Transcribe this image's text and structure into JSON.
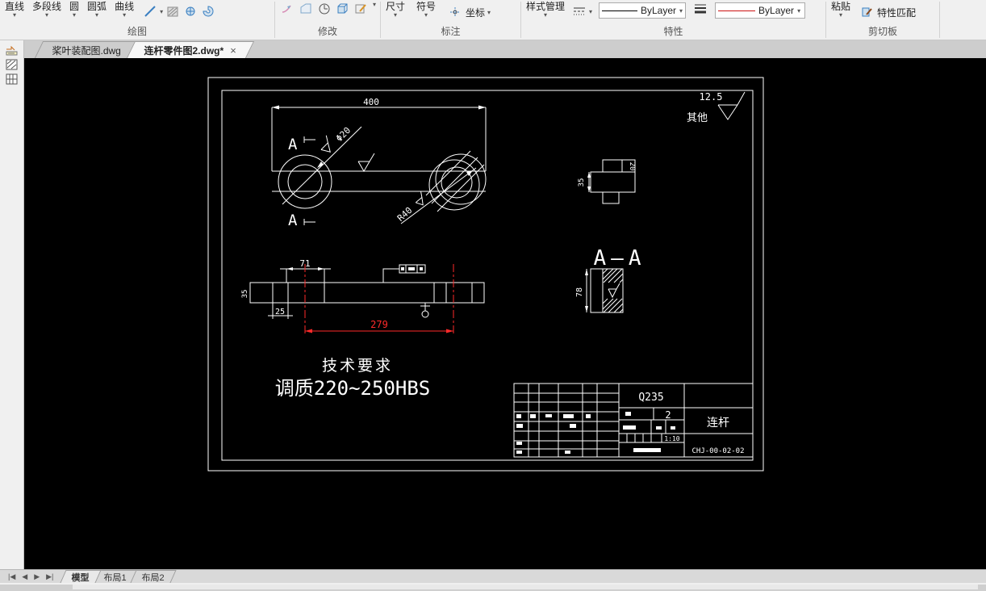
{
  "ribbon": {
    "draw": {
      "label": "绘图",
      "line": "直线",
      "polyline": "多段线",
      "circle": "圆",
      "arc": "圆弧",
      "curve": "曲线"
    },
    "modify": {
      "label": "修改"
    },
    "annotate": {
      "label": "标注",
      "dimension": "尺寸",
      "symbol": "符号",
      "coordinate": "坐标"
    },
    "properties": {
      "label": "特性",
      "style_manager": "样式管理",
      "linetype_value": "ByLayer",
      "color_value": "ByLayer"
    },
    "clipboard": {
      "label": "剪切板",
      "paste": "粘贴",
      "match_properties": "特性匹配"
    }
  },
  "file_tabs": [
    {
      "label": "桨叶装配图.dwg"
    },
    {
      "label": "连杆零件图2.dwg*"
    }
  ],
  "drawing": {
    "surface_note": {
      "value": "12.5",
      "other_text": "其他"
    },
    "top_view": {
      "length_dim": "400",
      "section_letter": "A",
      "hole_dim": "Φ20",
      "radius_dim": "R40"
    },
    "side_view": {
      "width_dim": "35",
      "depth_dim": "20"
    },
    "section_view": {
      "title": "A—A",
      "height_dim": "78"
    },
    "front_view": {
      "dim_71": "71",
      "dim_35": "35",
      "dim_25": "25",
      "dim_279": "279"
    },
    "tech_requirements": {
      "title": "技术要求",
      "line1": "调质220~250HBS"
    },
    "title_block": {
      "material": "Q235",
      "quantity": "2",
      "part_name": "连杆",
      "scale": "1:10",
      "drawing_no": "CHJ-00-02-02"
    }
  },
  "layout_tabs": {
    "model": "模型",
    "layout1": "布局1",
    "layout2": "布局2"
  },
  "colors": {
    "canvas_bg": "#000000",
    "line": "#ffffff",
    "dim_red": "#ff2a2a",
    "accent": "#3a7fc1"
  }
}
